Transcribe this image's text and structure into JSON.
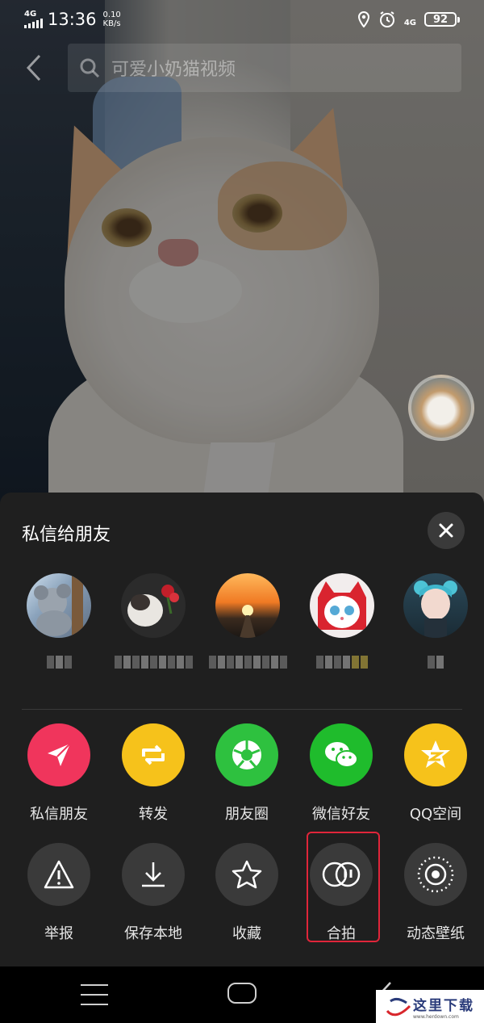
{
  "status_bar": {
    "network_left": "4G",
    "time": "13:36",
    "speed_value": "0.10",
    "speed_unit": "KB/s",
    "network_right": "4G",
    "battery": "92"
  },
  "search": {
    "query": "可爱小奶猫视频"
  },
  "share_sheet": {
    "title": "私信给朋友",
    "friends": [
      {
        "avatar": "koala-avatar"
      },
      {
        "avatar": "cat-with-flower-avatar"
      },
      {
        "avatar": "sunset-avatar"
      },
      {
        "avatar": "red-hood-cat-avatar"
      },
      {
        "avatar": "anime-girl-avatar"
      }
    ],
    "share_actions": [
      {
        "label": "私信朋友",
        "icon": "send-icon",
        "color": "#f0355c"
      },
      {
        "label": "转发",
        "icon": "repost-icon",
        "color": "#f6c21b"
      },
      {
        "label": "朋友圈",
        "icon": "moments-icon",
        "color": "#2ec13f"
      },
      {
        "label": "微信好友",
        "icon": "wechat-icon",
        "color": "#1fbc2c"
      },
      {
        "label": "QQ空间",
        "icon": "qzone-icon",
        "color": "#f6c21b"
      }
    ],
    "tool_actions": [
      {
        "label": "举报",
        "icon": "warning-icon"
      },
      {
        "label": "保存本地",
        "icon": "download-icon"
      },
      {
        "label": "收藏",
        "icon": "star-icon"
      },
      {
        "label": "合拍",
        "icon": "duet-icon"
      },
      {
        "label": "动态壁纸",
        "icon": "live-wallpaper-icon"
      }
    ]
  },
  "watermark": {
    "brand": "这里下载",
    "url": "www.herdown.com"
  }
}
